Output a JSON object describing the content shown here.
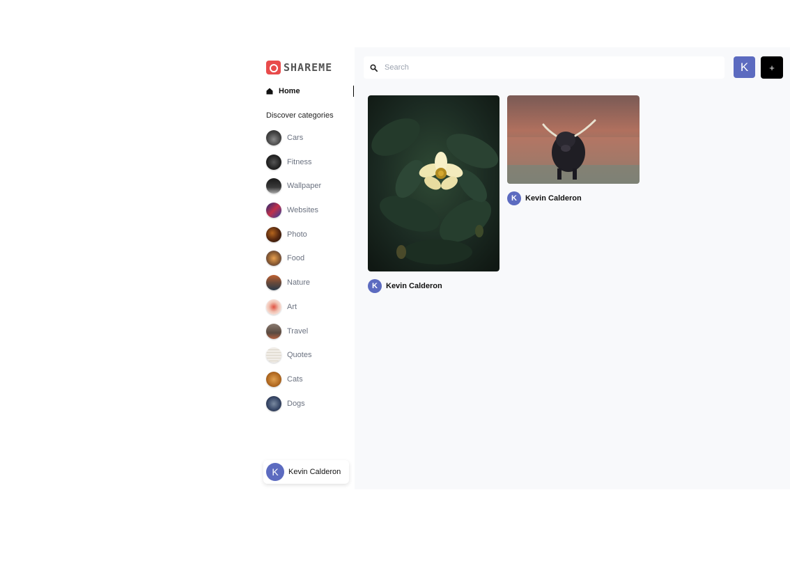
{
  "brand": {
    "name": "SHAREME",
    "icon": "camera-icon",
    "color": "#e84b4b"
  },
  "nav": {
    "home_label": "Home"
  },
  "categories_title": "Discover categories",
  "categories": [
    {
      "label": "Cars",
      "thumb": "car-thumbnail"
    },
    {
      "label": "Fitness",
      "thumb": "fitness-thumbnail"
    },
    {
      "label": "Wallpaper",
      "thumb": "wallpaper-thumbnail"
    },
    {
      "label": "Websites",
      "thumb": "websites-thumbnail"
    },
    {
      "label": "Photo",
      "thumb": "photo-thumbnail"
    },
    {
      "label": "Food",
      "thumb": "food-thumbnail"
    },
    {
      "label": "Nature",
      "thumb": "nature-thumbnail"
    },
    {
      "label": "Art",
      "thumb": "art-thumbnail"
    },
    {
      "label": "Travel",
      "thumb": "travel-thumbnail"
    },
    {
      "label": "Quotes",
      "thumb": "quotes-thumbnail"
    },
    {
      "label": "Cats",
      "thumb": "cats-thumbnail"
    },
    {
      "label": "Dogs",
      "thumb": "dogs-thumbnail"
    }
  ],
  "user": {
    "name": "Kevin Calderon",
    "initial": "K",
    "avatar_color": "#5c6bc0"
  },
  "search": {
    "placeholder": "Search",
    "value": ""
  },
  "header": {
    "add_label": "+"
  },
  "pins": [
    {
      "image": "yellow-flower-photo",
      "author": "Kevin Calderon",
      "author_initial": "K"
    },
    {
      "image": "highland-cow-photo",
      "author": "Kevin Calderon",
      "author_initial": "K"
    }
  ]
}
